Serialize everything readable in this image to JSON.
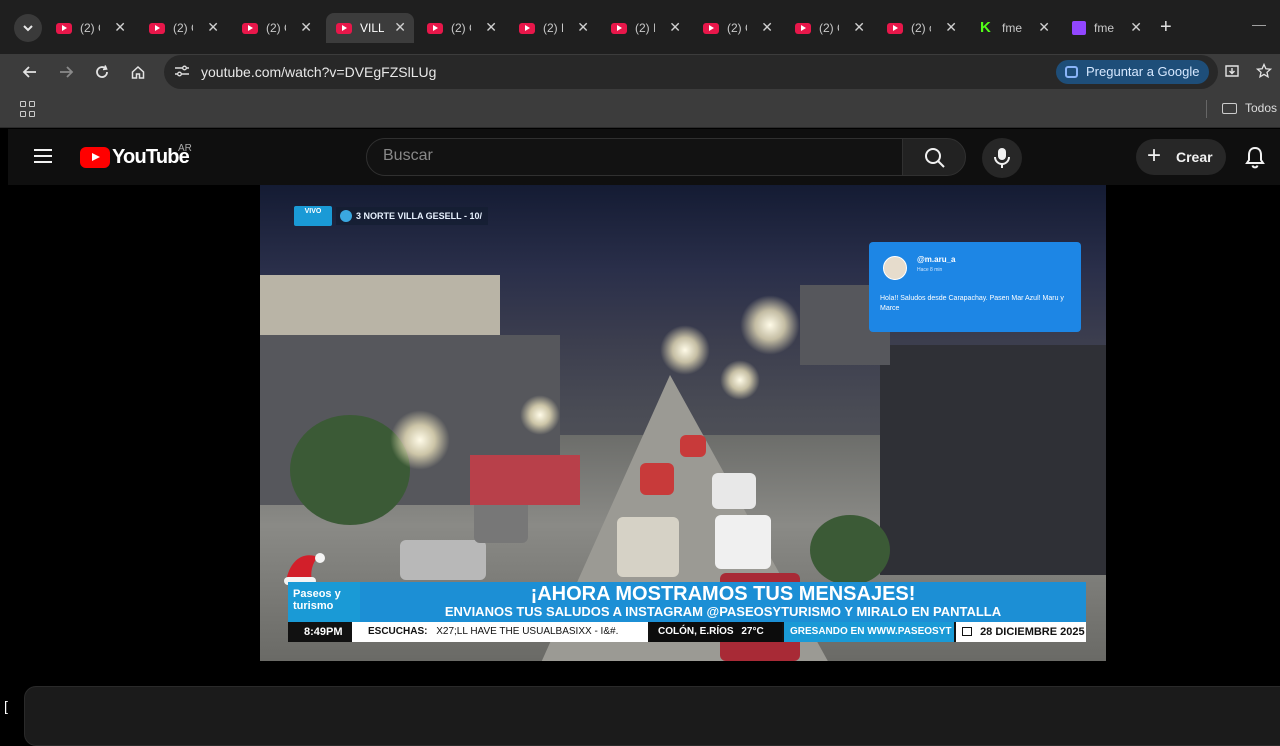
{
  "browser": {
    "tabs": [
      {
        "title": "(2) C",
        "favicon": "youtube-icon",
        "active": false
      },
      {
        "title": "(2) C",
        "favicon": "youtube-icon",
        "active": false
      },
      {
        "title": "(2) C",
        "favicon": "youtube-icon",
        "active": false
      },
      {
        "title": "VILL",
        "favicon": "youtube-icon",
        "active": true
      },
      {
        "title": "(2) C",
        "favicon": "youtube-icon",
        "active": false
      },
      {
        "title": "(2) E",
        "favicon": "youtube-icon",
        "active": false
      },
      {
        "title": "(2) I",
        "favicon": "youtube-icon",
        "active": false
      },
      {
        "title": "(2) C",
        "favicon": "youtube-icon",
        "active": false
      },
      {
        "title": "(2) C",
        "favicon": "youtube-icon",
        "active": false
      },
      {
        "title": "(2) c",
        "favicon": "youtube-icon",
        "active": false
      },
      {
        "title": "fme",
        "favicon": "kick-icon",
        "active": false
      },
      {
        "title": "fme",
        "favicon": "twitch-icon",
        "active": false
      }
    ],
    "new_tab": "+",
    "url": "youtube.com/watch?v=DVEgFZSlLUg",
    "ask_google": "Preguntar a Google",
    "bookmarks_folder": "Todos"
  },
  "youtube": {
    "logo_text": "YouTube",
    "region": "AR",
    "search_placeholder": "Buscar",
    "create_label": "Crear"
  },
  "video": {
    "live_badge": "VIVO",
    "location": "3 NORTE VILLA GESELL - 10/",
    "message_card": {
      "user": "@m.aru_a",
      "ago": "Hace 8 min",
      "text": "Hola!! Saludos desde Carapachay. Pasen Mar Azul! Maru y Marce"
    },
    "brand_logo": "Paseos y turismo",
    "headline": "¡AHORA MOSTRAMOS TUS MENSAJES!",
    "subheadline": "ENVIANOS TUS SALUDOS A INSTAGRAM @PASEOSYTURISMO Y MIRALO EN PANTALLA",
    "ticker": {
      "time": "8:49PM",
      "song_prefix": "ESCUCHAS:",
      "song": "X27;LL HAVE THE USUALBASIXX - I&#.",
      "weather_city": "COLÓN, E.RÍOS",
      "weather_temp": "27°C",
      "web": "GRESANDO EN WWW.PASEOSYT",
      "date": "28 DICIEMBRE 2025"
    }
  },
  "colors": {
    "youtube_red": "#ff0000",
    "banner_blue": "#1c8fd5",
    "card_blue": "#1d86e5",
    "ask_google_bg": "#1e4e79"
  }
}
